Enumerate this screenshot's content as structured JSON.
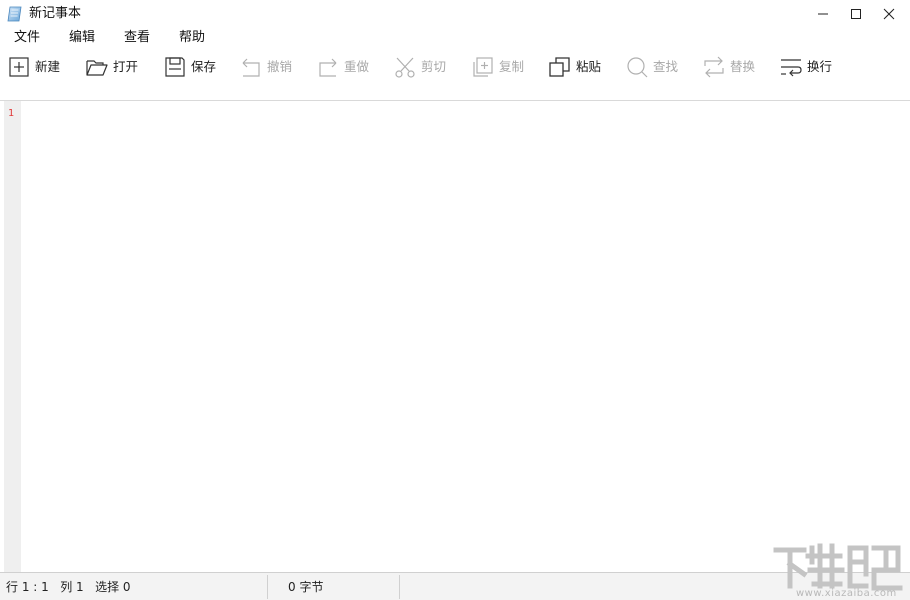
{
  "window": {
    "title": "新记事本",
    "icon": "notepad-app-icon",
    "controls": [
      "minimize-icon",
      "maximize-icon",
      "close-icon"
    ]
  },
  "menu": {
    "items": [
      {
        "label": "文件"
      },
      {
        "label": "编辑"
      },
      {
        "label": "查看"
      },
      {
        "label": "帮助"
      }
    ]
  },
  "toolbar": {
    "items": [
      {
        "label": "新建",
        "icon": "new-file-icon",
        "enabled": true
      },
      {
        "label": "打开",
        "icon": "open-folder-icon",
        "enabled": true
      },
      {
        "label": "保存",
        "icon": "save-icon",
        "enabled": true
      },
      {
        "label": "撤销",
        "icon": "undo-icon",
        "enabled": false
      },
      {
        "label": "重做",
        "icon": "redo-icon",
        "enabled": false
      },
      {
        "label": "剪切",
        "icon": "cut-icon",
        "enabled": false
      },
      {
        "label": "复制",
        "icon": "copy-icon",
        "enabled": false
      },
      {
        "label": "粘贴",
        "icon": "paste-icon",
        "enabled": true
      },
      {
        "label": "查找",
        "icon": "search-icon",
        "enabled": false
      },
      {
        "label": "替换",
        "icon": "replace-icon",
        "enabled": false
      },
      {
        "label": "换行",
        "icon": "wrap-icon",
        "enabled": true
      }
    ]
  },
  "editor": {
    "line_numbers": [
      "1"
    ],
    "content": "",
    "line_number_color": "#e03a3a"
  },
  "status": {
    "position": "行 1 : 1   列 1   选择 0",
    "bytes": "0 字节"
  },
  "watermark": {
    "text": "www.xiazaiba.com"
  },
  "colors": {
    "enabled_icon": "#333333",
    "disabled_icon": "#b0b0b0"
  }
}
